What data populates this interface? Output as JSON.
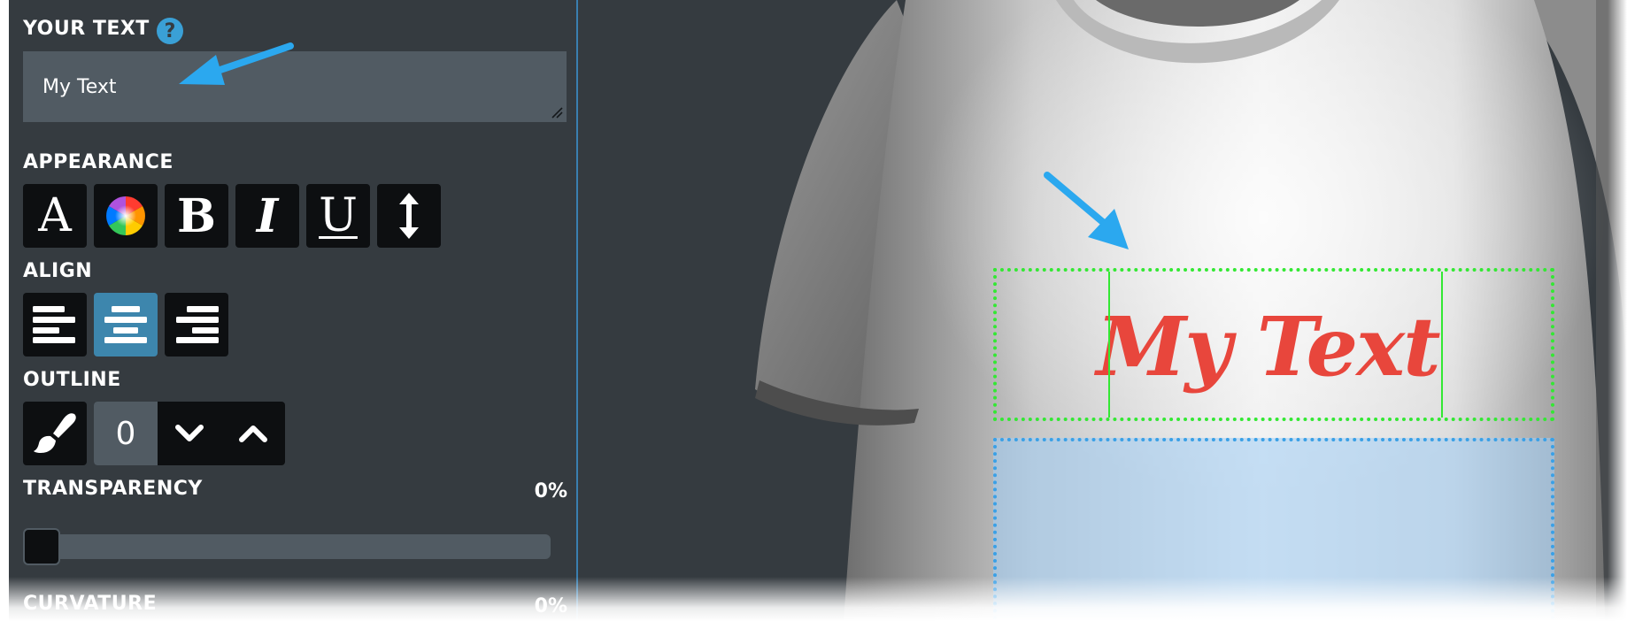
{
  "panel": {
    "your_text_label": "YOUR TEXT",
    "help_glyph": "?",
    "text_value": "My Text",
    "appearance_label": "APPEARANCE",
    "appearance_buttons": {
      "font": "A",
      "color": "color-wheel-icon",
      "bold": "B",
      "italic": "I",
      "underline": "U",
      "line_height": "vertical-arrows-icon"
    },
    "align_label": "ALIGN",
    "align_selected": "center",
    "outline_label": "OUTLINE",
    "outline_value": "0",
    "transparency_label": "TRANSPARENCY",
    "transparency_value": "0%",
    "curvature_label": "CURVATURE",
    "curvature_value": "0%"
  },
  "canvas": {
    "design_text": "My Text",
    "design_text_color": "#e8463c"
  },
  "colors": {
    "panel_bg": "#353b40",
    "input_bg": "#515b63",
    "button_bg": "#0d0f11",
    "active_accent": "#3d86ad",
    "annotation_arrow": "#2ba8ef",
    "text_box_border": "#33e833",
    "print_area_border": "#3aa0e6"
  }
}
